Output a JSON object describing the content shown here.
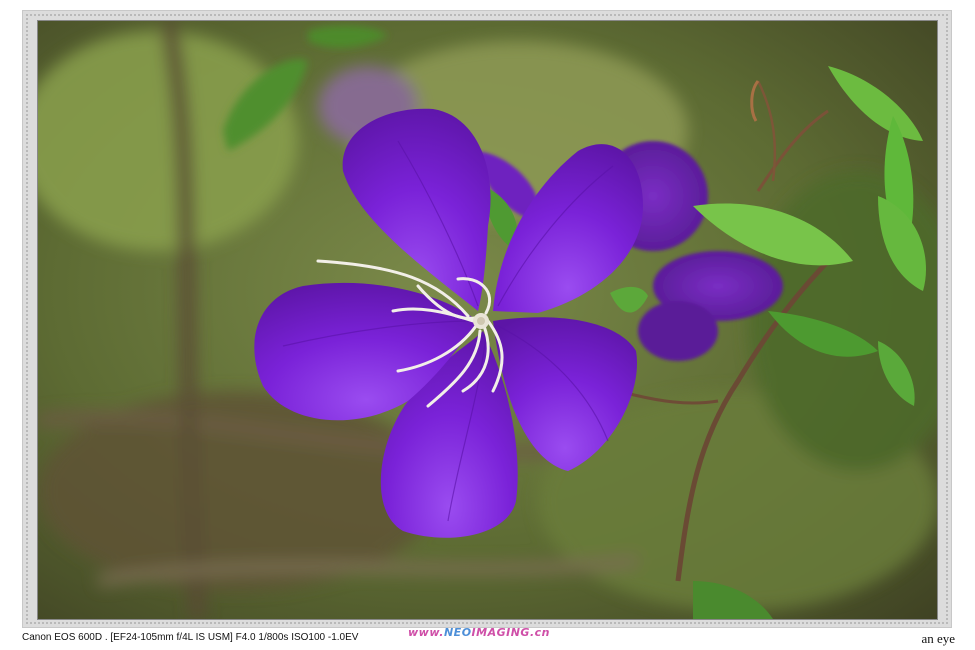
{
  "caption": {
    "exif": "Canon EOS 600D . [EF24-105mm f/4L IS USM] F4.0 1/800s ISO100 -1.0EV",
    "watermark": "www.neoimaging.cn",
    "author": "an eye"
  },
  "colors": {
    "petal": "#7d27d6",
    "petal_dark": "#5a14a8",
    "leaf": "#5fb83a",
    "background_green": "#6f8a3a",
    "frame": "#dcdcdc"
  }
}
